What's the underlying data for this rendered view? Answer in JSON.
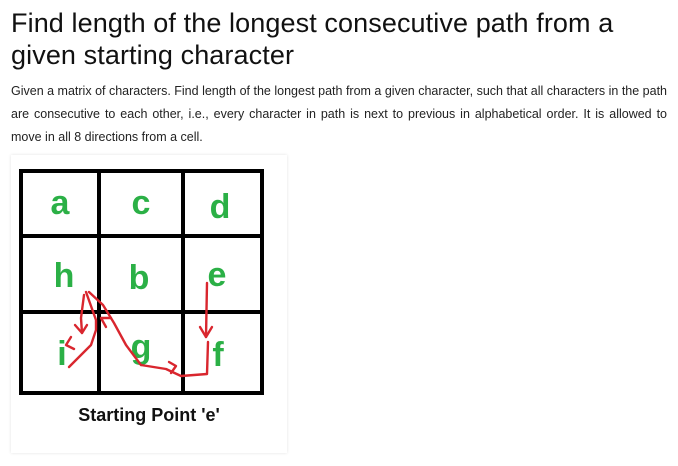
{
  "article": {
    "title": "Find length of the longest consecutive path from a given starting character",
    "description": "Given a matrix of characters. Find length of the longest path from a given character, such that all characters in the path are consecutive to each other, i.e., every character in path is next to previous in alphabetical order. It is allowed to move in all 8 directions from a cell."
  },
  "figure": {
    "grid": [
      [
        "a",
        "c",
        "d"
      ],
      [
        "h",
        "b",
        "e"
      ],
      [
        "i",
        "g",
        "f"
      ]
    ],
    "caption": "Starting Point 'e'",
    "colors": {
      "letter": "#2bb046",
      "grid_line": "#000000",
      "path": "#d9262e"
    }
  }
}
